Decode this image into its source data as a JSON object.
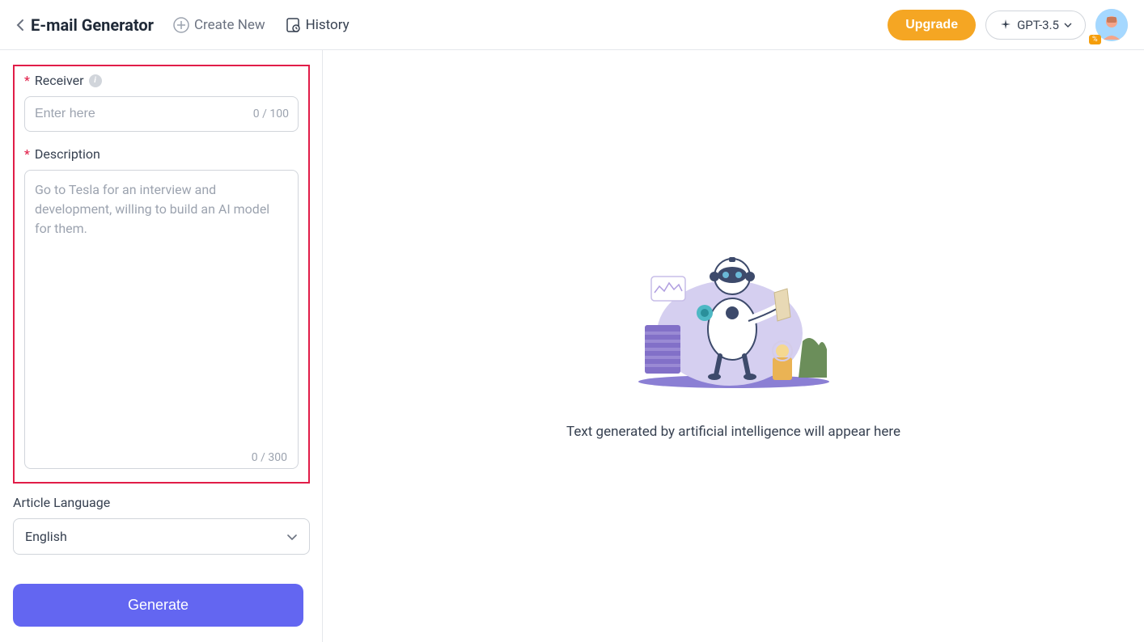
{
  "header": {
    "title": "E-mail Generator",
    "create_new": "Create New",
    "history": "History",
    "upgrade": "Upgrade",
    "model": "GPT-3.5",
    "avatar_badge": "%"
  },
  "form": {
    "receiver_label": "Receiver",
    "receiver_placeholder": "Enter here",
    "receiver_count": "0 / 100",
    "description_label": "Description",
    "description_placeholder": "Go to Tesla for an interview and development, willing to build an AI model for them.",
    "description_count": "0 / 300",
    "language_label": "Article Language",
    "language_value": "English",
    "generate": "Generate"
  },
  "main": {
    "placeholder": "Text generated by artificial intelligence will appear here"
  }
}
